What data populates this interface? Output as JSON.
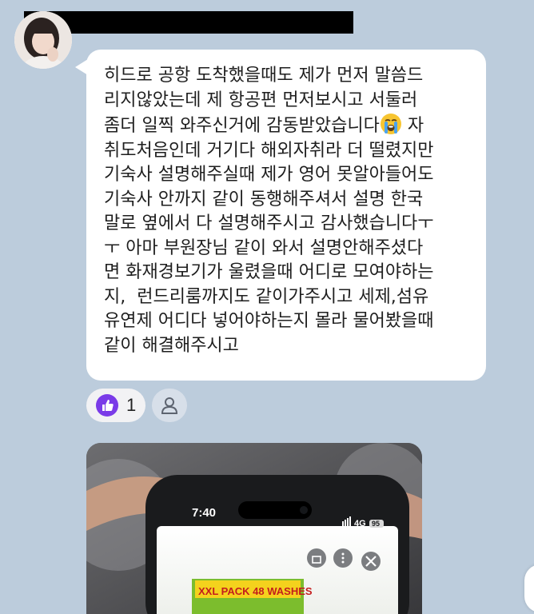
{
  "message": {
    "text_before_emoji": "히드로 공항 도착했을때도 제가 먼저 말씀드\n리지않았는데 제 항공편 먼저보시고 서둘러\n좀더 일찍 와주신거에 감동받았습니다",
    "emoji": "loudly-crying-face",
    "text_after_emoji": " 자\n취도처음인데 거기다 해외자취라 더 떨렸지만\n기숙사 설명해주실때 제가 영어 못알아들어도\n기숙사 안까지 같이 동행해주셔서 설명 한국\n말로 옆에서 다 설명해주시고 감사했습니다ㅜ\nㅜ 아마 부원장님 같이 와서 설명안해주셨다\n면 화재경보기가 울렸을때 어디로 모여야하는\n지,  런드리룸까지도 같이가주시고 세제,섬유\n유연제 어디다 넣어야하는지 몰라 물어봤을때\n같이 해결해주시고"
  },
  "reaction": {
    "icon": "thumbs-up-icon",
    "count": "1",
    "color": "#7a3be8"
  },
  "member_button_icon": "person-icon",
  "photo": {
    "phone_time": "7:40",
    "network": "4G",
    "battery": "95",
    "product_banner": "XXL PACK 48 WASHES"
  },
  "colors": {
    "background": "#bcccdc",
    "bubble": "#ffffff",
    "reaction_pill": "#f2f2f4"
  }
}
